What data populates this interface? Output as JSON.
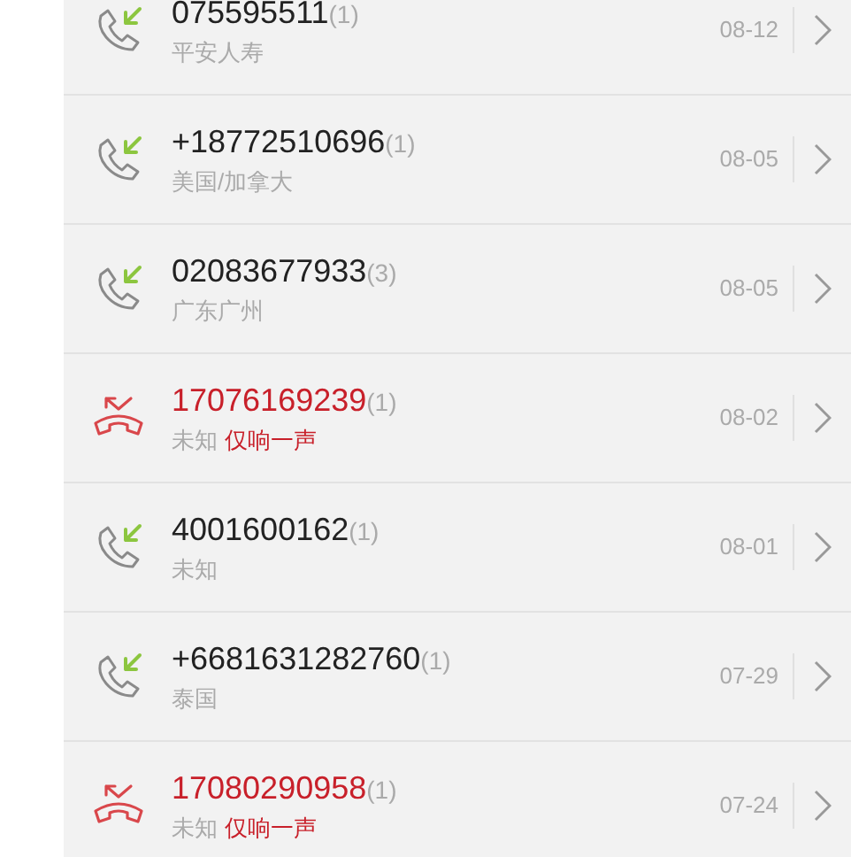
{
  "calls": [
    {
      "kind": "incoming",
      "number": "075595511",
      "count": "(1)",
      "location": "平安人寿",
      "date": "08-12"
    },
    {
      "kind": "incoming",
      "number": "+18772510696",
      "count": "(1)",
      "location": "美国/加拿大",
      "date": "08-05"
    },
    {
      "kind": "incoming",
      "number": "02083677933",
      "count": "(3)",
      "location": "广东广州",
      "date": "08-05"
    },
    {
      "kind": "missed",
      "number": "17076169239",
      "count": "(1)",
      "location": "未知",
      "tag": "仅响一声",
      "date": "08-02"
    },
    {
      "kind": "incoming",
      "number": "4001600162",
      "count": "(1)",
      "location": "未知",
      "date": "08-01"
    },
    {
      "kind": "incoming",
      "number": "+6681631282760",
      "count": "(1)",
      "location": "泰国",
      "date": "07-29"
    },
    {
      "kind": "missed",
      "number": "17080290958",
      "count": "(1)",
      "location": "未知",
      "tag": "仅响一声",
      "date": "07-24"
    }
  ]
}
